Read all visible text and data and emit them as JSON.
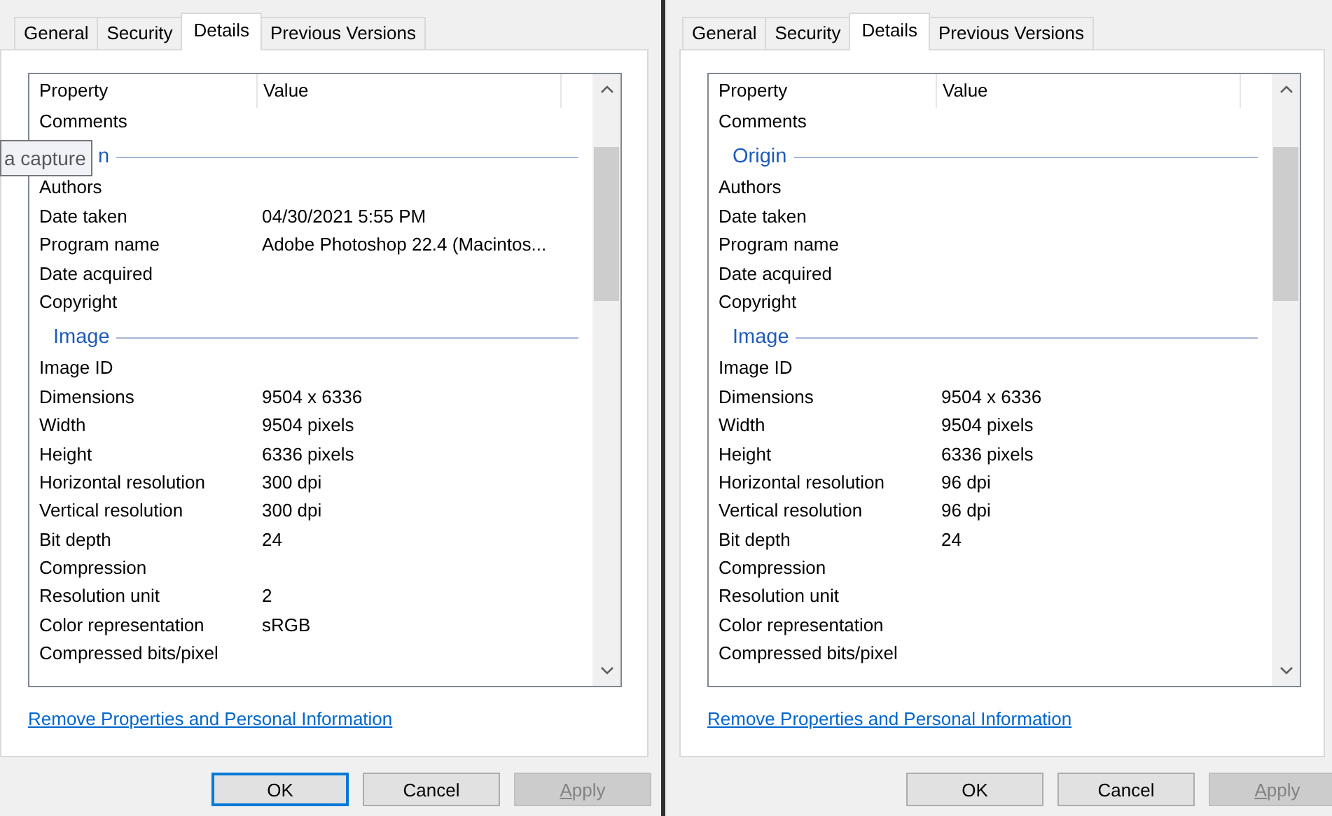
{
  "dialogs": [
    {
      "tabs": [
        {
          "label": "General",
          "selected": false
        },
        {
          "label": "Security",
          "selected": false
        },
        {
          "label": "Details",
          "selected": true
        },
        {
          "label": "Previous Versions",
          "selected": false
        }
      ],
      "columns": [
        "Property",
        "Value"
      ],
      "items": [
        {
          "kind": "row",
          "property": "Comments"
        },
        {
          "kind": "heading",
          "label": "n",
          "partly_covered": true
        },
        {
          "kind": "row",
          "property": "Authors"
        },
        {
          "kind": "row",
          "property": "Date taken",
          "value": "04/30/2021 5:55 PM"
        },
        {
          "kind": "row",
          "property": "Program name",
          "value": "Adobe Photoshop 22.4 (Macintos..."
        },
        {
          "kind": "row",
          "property": "Date acquired"
        },
        {
          "kind": "row",
          "property": "Copyright"
        },
        {
          "kind": "heading",
          "label": "Image"
        },
        {
          "kind": "row",
          "property": "Image ID"
        },
        {
          "kind": "row",
          "property": "Dimensions",
          "value": "9504 x 6336"
        },
        {
          "kind": "row",
          "property": "Width",
          "value": "9504 pixels"
        },
        {
          "kind": "row",
          "property": "Height",
          "value": "6336 pixels"
        },
        {
          "kind": "row",
          "property": "Horizontal resolution",
          "value": "300 dpi"
        },
        {
          "kind": "row",
          "property": "Vertical resolution",
          "value": "300 dpi"
        },
        {
          "kind": "row",
          "property": "Bit depth",
          "value": "24"
        },
        {
          "kind": "row",
          "property": "Compression"
        },
        {
          "kind": "row",
          "property": "Resolution unit",
          "value": "2"
        },
        {
          "kind": "row",
          "property": "Color representation",
          "value": "sRGB"
        },
        {
          "kind": "row",
          "property": "Compressed bits/pixel"
        }
      ],
      "tooltip": "a capture",
      "link": "Remove Properties and Personal Information",
      "buttons": [
        {
          "label": "OK",
          "default": true,
          "disabled": false,
          "access_key": false
        },
        {
          "label": "Cancel",
          "default": false,
          "disabled": false,
          "access_key": false
        },
        {
          "label": "Apply",
          "default": false,
          "disabled": true,
          "access_key": true
        }
      ]
    },
    {
      "tabs": [
        {
          "label": "General",
          "selected": false
        },
        {
          "label": "Security",
          "selected": false
        },
        {
          "label": "Details",
          "selected": true
        },
        {
          "label": "Previous Versions",
          "selected": false
        }
      ],
      "columns": [
        "Property",
        "Value"
      ],
      "items": [
        {
          "kind": "row",
          "property": "Comments"
        },
        {
          "kind": "heading",
          "label": "Origin"
        },
        {
          "kind": "row",
          "property": "Authors"
        },
        {
          "kind": "row",
          "property": "Date taken"
        },
        {
          "kind": "row",
          "property": "Program name"
        },
        {
          "kind": "row",
          "property": "Date acquired"
        },
        {
          "kind": "row",
          "property": "Copyright"
        },
        {
          "kind": "heading",
          "label": "Image"
        },
        {
          "kind": "row",
          "property": "Image ID"
        },
        {
          "kind": "row",
          "property": "Dimensions",
          "value": "9504 x 6336"
        },
        {
          "kind": "row",
          "property": "Width",
          "value": "9504 pixels"
        },
        {
          "kind": "row",
          "property": "Height",
          "value": "6336 pixels"
        },
        {
          "kind": "row",
          "property": "Horizontal resolution",
          "value": "96 dpi"
        },
        {
          "kind": "row",
          "property": "Vertical resolution",
          "value": "96 dpi"
        },
        {
          "kind": "row",
          "property": "Bit depth",
          "value": "24"
        },
        {
          "kind": "row",
          "property": "Compression"
        },
        {
          "kind": "row",
          "property": "Resolution unit"
        },
        {
          "kind": "row",
          "property": "Color representation"
        },
        {
          "kind": "row",
          "property": "Compressed bits/pixel"
        }
      ],
      "link": "Remove Properties and Personal Information",
      "buttons": [
        {
          "label": "OK",
          "default": false,
          "disabled": false,
          "access_key": false
        },
        {
          "label": "Cancel",
          "default": false,
          "disabled": false,
          "access_key": false
        },
        {
          "label": "Apply",
          "default": false,
          "disabled": true,
          "access_key": true
        }
      ]
    }
  ]
}
